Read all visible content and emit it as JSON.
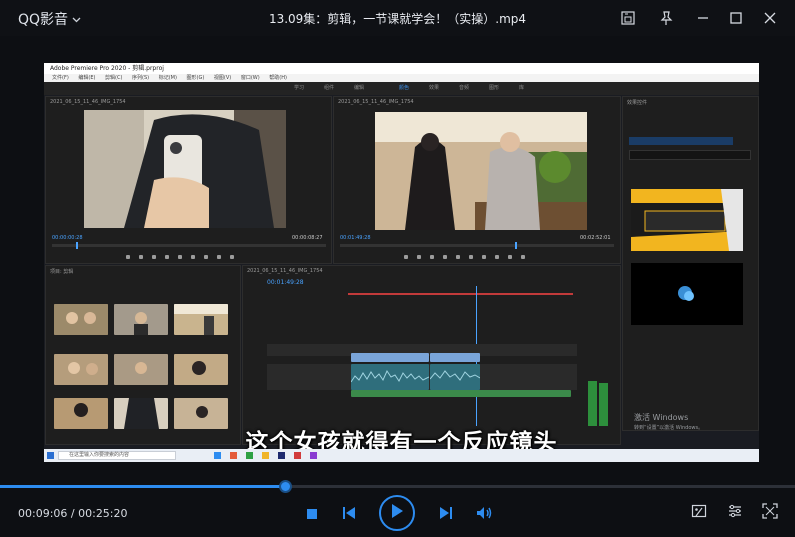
{
  "app": {
    "brand": "QQ影音",
    "title": "13.09集：剪辑，一节课就学会！（实操）.mp4"
  },
  "player": {
    "current_time": "00:09:06",
    "total_time": "00:25:20",
    "separator": " / ",
    "progress": 0.359
  },
  "subtitle": "这个女孩就得有一个反应镜头",
  "screen": {
    "window_title": "Adobe Premiere Pro 2020 - 剪辑.prproj",
    "menu": [
      "文件(F)",
      "编辑(E)",
      "剪辑(C)",
      "序列(S)",
      "标记(M)",
      "图形(G)",
      "视图(V)",
      "窗口(W)",
      "帮助(H)"
    ],
    "workspaces": [
      "学习",
      "组件",
      "编辑",
      "颜色",
      "效果",
      "音频",
      "图形",
      "库"
    ],
    "source_timecode": "00:00:00:28",
    "source_duration": "00:00:08:27",
    "program_timecode": "00:01:49:28",
    "program_duration": "00:02:52:01",
    "timeline_timecode": "00:01:49:28",
    "effects_header": "效果控件",
    "project_header": "项目: 剪辑",
    "sequence_tab": "2021_06_15_11_46_IMG_1754",
    "activate_line1": "激活 Windows",
    "activate_line2": "转到“设置”以激活 Windows。",
    "taskbar_search": "在这里输入你要搜索的内容"
  },
  "icons": {
    "brand_chevron": "chevron-down-icon",
    "screen_capture": "screen-capture-icon",
    "pin": "pin-icon",
    "minimize": "minimize-icon",
    "maximize": "maximize-icon",
    "close": "close-icon",
    "stop": "stop-icon",
    "prev": "previous-icon",
    "play": "play-icon",
    "next": "next-icon",
    "volume": "volume-icon",
    "screenshot": "screenshot-icon",
    "settings": "settings-icon",
    "fullscreen": "fullscreen-icon"
  },
  "colors": {
    "accent": "#2d8cf0",
    "background": "#0d0f13"
  }
}
